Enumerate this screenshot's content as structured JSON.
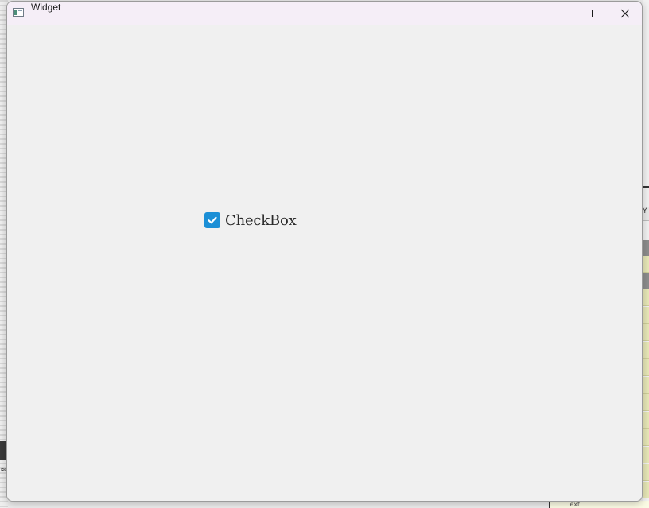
{
  "window": {
    "title": "Widget",
    "controls": [
      "minimize",
      "maximize",
      "close"
    ]
  },
  "checkbox": {
    "label": "CheckBox",
    "checked": true,
    "accent_color": "#1b8fd6"
  },
  "background": {
    "right_panel_fragment": "Y",
    "bottom_fragment": "Text",
    "left_fragment": "≈"
  },
  "icons": [
    "app-window-icon",
    "minimize-icon",
    "maximize-icon",
    "close-icon",
    "checkmark-icon"
  ]
}
